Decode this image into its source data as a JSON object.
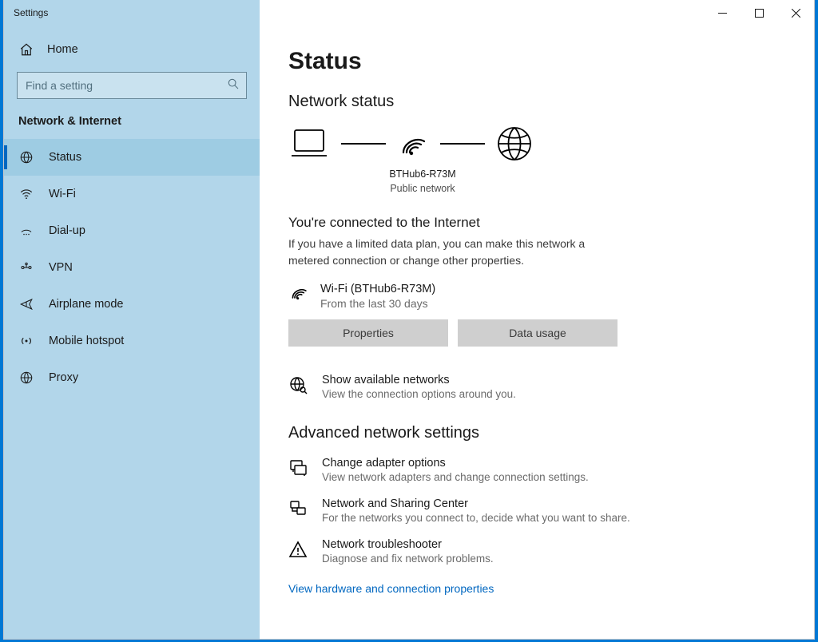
{
  "window": {
    "title": "Settings"
  },
  "sidebar": {
    "home_label": "Home",
    "search_placeholder": "Find a setting",
    "category_title": "Network & Internet",
    "items": [
      {
        "label": "Status"
      },
      {
        "label": "Wi-Fi"
      },
      {
        "label": "Dial-up"
      },
      {
        "label": "VPN"
      },
      {
        "label": "Airplane mode"
      },
      {
        "label": "Mobile hotspot"
      },
      {
        "label": "Proxy"
      }
    ]
  },
  "main": {
    "page_title": "Status",
    "network_status_heading": "Network status",
    "diagram": {
      "ssid": "BTHub6-R73M",
      "network_type": "Public network"
    },
    "connected": {
      "title": "You're connected to the Internet",
      "desc": "If you have a limited data plan, you can make this network a metered connection or change other properties.",
      "conn_name": "Wi-Fi (BTHub6-R73M)",
      "conn_period": "From the last 30 days",
      "properties_btn": "Properties",
      "data_usage_btn": "Data usage"
    },
    "available": {
      "title": "Show available networks",
      "desc": "View the connection options around you."
    },
    "advanced_heading": "Advanced network settings",
    "adapter": {
      "title": "Change adapter options",
      "desc": "View network adapters and change connection settings."
    },
    "sharing": {
      "title": "Network and Sharing Center",
      "desc": "For the networks you connect to, decide what you want to share."
    },
    "troubleshoot": {
      "title": "Network troubleshooter",
      "desc": "Diagnose and fix network problems."
    },
    "hw_link": "View hardware and connection properties"
  }
}
